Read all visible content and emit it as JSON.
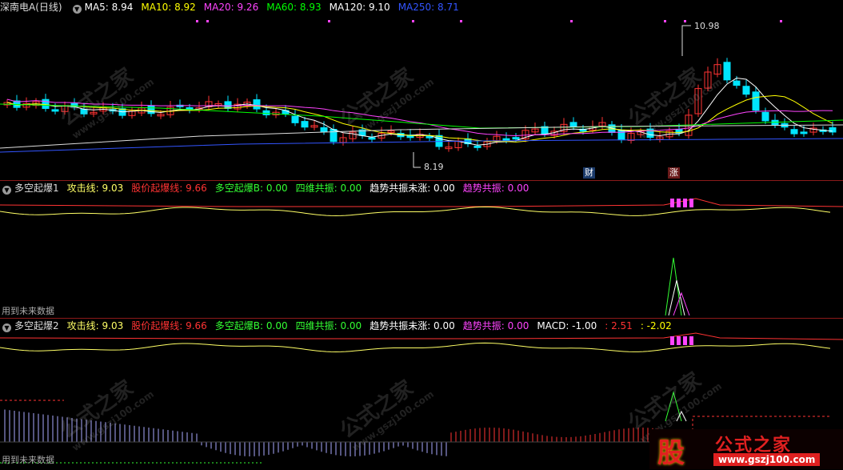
{
  "panel1": {
    "stock_name": "深南电A",
    "period": "(日线)",
    "ma": [
      {
        "label": "MA5: 8.94",
        "color": "#ffffff"
      },
      {
        "label": "MA10: 8.92",
        "color": "#ffff00"
      },
      {
        "label": "MA20: 9.26",
        "color": "#ff44ff"
      },
      {
        "label": "MA60: 8.93",
        "color": "#00ff00"
      },
      {
        "label": "MA120: 9.10",
        "color": "#ffffff"
      },
      {
        "label": "MA250: 8.71",
        "color": "#3355ff"
      }
    ],
    "high_label": "10.98",
    "low_label": "8.19",
    "tag_cai": "财",
    "tag_zhang": "涨"
  },
  "panel2": {
    "title": "多空起爆1",
    "fields": [
      {
        "label": "攻击线: 9.03",
        "color": "#ffff66"
      },
      {
        "label": "股价起爆线: 9.66",
        "color": "#ff3333"
      },
      {
        "label": "多空起爆B: 0.00",
        "color": "#33ff33"
      },
      {
        "label": "四维共振: 0.00",
        "color": "#33ff33"
      },
      {
        "label": "趋势共振未涨: 0.00",
        "color": "#ffffff"
      },
      {
        "label": "趋势共振: 0.00",
        "color": "#ff44ff"
      }
    ],
    "footer_note": "用到未来数据"
  },
  "panel3": {
    "title": "多空起爆2",
    "fields": [
      {
        "label": "攻击线: 9.03",
        "color": "#ffff66"
      },
      {
        "label": "股价起爆线: 9.66",
        "color": "#ff3333"
      },
      {
        "label": "多空起爆B: 0.00",
        "color": "#33ff33"
      },
      {
        "label": "四维共振: 0.00",
        "color": "#33ff33"
      },
      {
        "label": "趋势共振未涨: 0.00",
        "color": "#ffffff"
      },
      {
        "label": "趋势共振: 0.00",
        "color": "#ff44ff"
      },
      {
        "label": "MACD: -1.00",
        "color": "#ffffff"
      },
      {
        "label": ": 2.51",
        "color": "#ff3333"
      },
      {
        "label": ": -2.02",
        "color": "#ffff00"
      }
    ],
    "footer_note": "用到未来数据"
  },
  "watermark": {
    "text": "公式之家",
    "url": "www.gszj100.com"
  },
  "logo": {
    "glyph": "股",
    "name": "公式之家",
    "url": "www.gszj100.com"
  },
  "colors": {
    "up": "#ff3333",
    "down": "#00e5ff",
    "bg": "#000000",
    "divider": "#8b1a1a"
  }
}
